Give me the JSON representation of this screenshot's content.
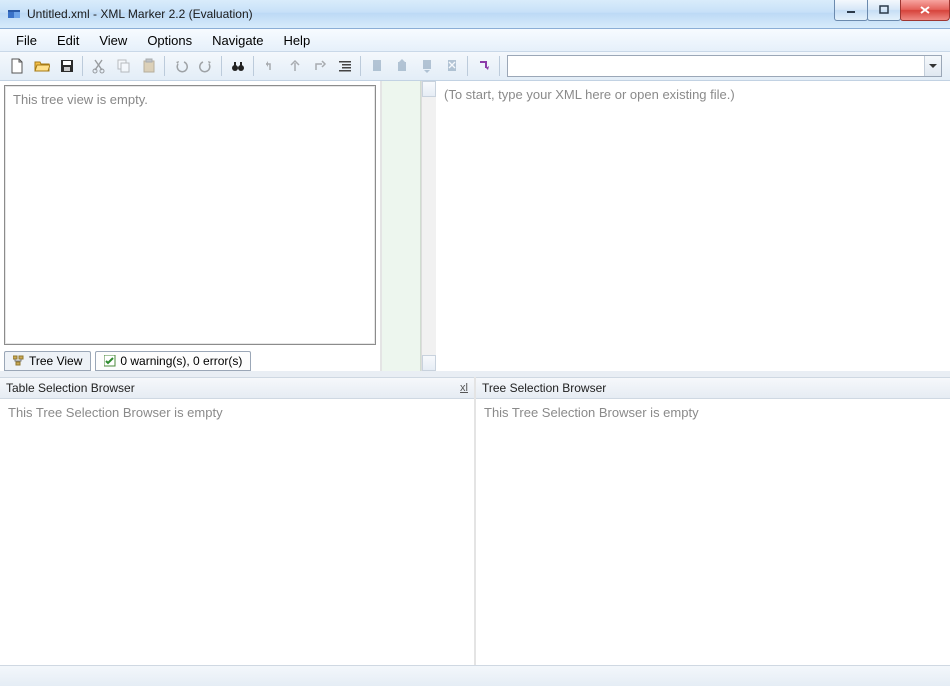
{
  "window": {
    "title": "Untitled.xml - XML Marker 2.2 (Evaluation)"
  },
  "menu": {
    "file": "File",
    "edit": "Edit",
    "view": "View",
    "options": "Options",
    "navigate": "Navigate",
    "help": "Help"
  },
  "tree": {
    "empty_text": "This tree view is empty."
  },
  "tabs": {
    "tree_view": "Tree View",
    "errors": "0 warning(s), 0 error(s)"
  },
  "editor": {
    "placeholder": "(To start, type your XML here or open existing file.)"
  },
  "panes": {
    "table_title": "Table Selection Browser",
    "table_empty": "This Tree Selection Browser is empty",
    "tree_title": "Tree Selection Browser",
    "tree_empty": "This Tree Selection Browser is empty",
    "close_label": "xl"
  }
}
